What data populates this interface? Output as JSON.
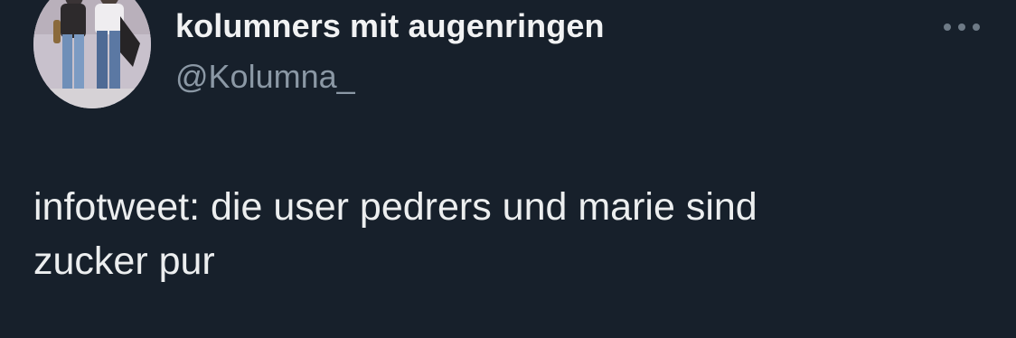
{
  "author": {
    "display_name": "kolumners mit augenringen",
    "handle": "@Kolumna_"
  },
  "tweet": {
    "text": "infotweet: die user pedrers und marie sind\nzucker pur"
  },
  "icons": {
    "more": "more-horizontal-icon",
    "avatar": "profile-photo"
  },
  "colors": {
    "background": "#17202b",
    "primary_text": "#e7e9ea",
    "secondary_text": "#8b98a5"
  }
}
